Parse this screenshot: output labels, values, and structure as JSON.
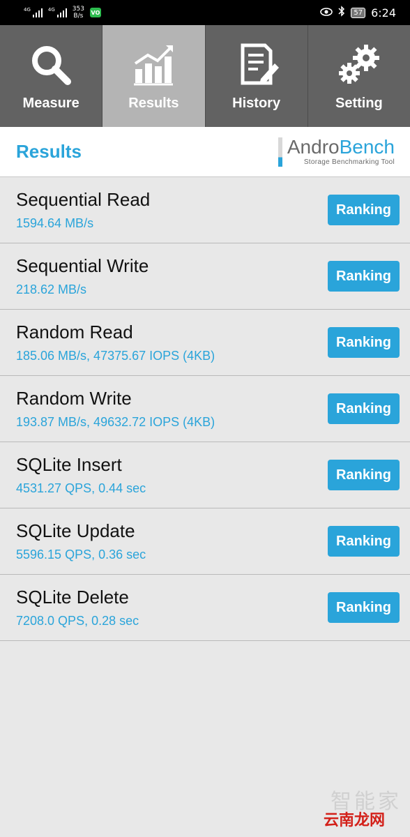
{
  "status_bar": {
    "signal1_label": "4G",
    "signal2_label": "4G",
    "net_speed_value": "353",
    "net_speed_unit": "B/s",
    "vo_badge": "VO",
    "battery": "57",
    "time": "6:24"
  },
  "tabs": [
    {
      "label": "Measure",
      "icon": "magnifier-icon"
    },
    {
      "label": "Results",
      "icon": "bar-chart-trend-icon",
      "active": true
    },
    {
      "label": "History",
      "icon": "document-edit-icon"
    },
    {
      "label": "Setting",
      "icon": "gears-icon"
    }
  ],
  "header": {
    "title": "Results",
    "logo_part1": "Andro",
    "logo_part2": "Bench",
    "logo_subtitle": "Storage Benchmarking Tool"
  },
  "results": [
    {
      "name": "Sequential Read",
      "value": "1594.64 MB/s",
      "button": "Ranking"
    },
    {
      "name": "Sequential Write",
      "value": "218.62 MB/s",
      "button": "Ranking"
    },
    {
      "name": "Random Read",
      "value": "185.06 MB/s, 47375.67 IOPS (4KB)",
      "button": "Ranking"
    },
    {
      "name": "Random Write",
      "value": "193.87 MB/s, 49632.72 IOPS (4KB)",
      "button": "Ranking"
    },
    {
      "name": "SQLite Insert",
      "value": "4531.27 QPS, 0.44 sec",
      "button": "Ranking"
    },
    {
      "name": "SQLite Update",
      "value": "5596.15 QPS, 0.36 sec",
      "button": "Ranking"
    },
    {
      "name": "SQLite Delete",
      "value": "7208.0 QPS, 0.28 sec",
      "button": "Ranking"
    }
  ],
  "watermark": {
    "line1": "智能家",
    "line2": "云南龙网"
  },
  "colors": {
    "accent": "#2aa4da",
    "tab_bg": "#626262",
    "tab_active_bg": "#b4b4b4",
    "page_bg": "#e8e8e8"
  }
}
